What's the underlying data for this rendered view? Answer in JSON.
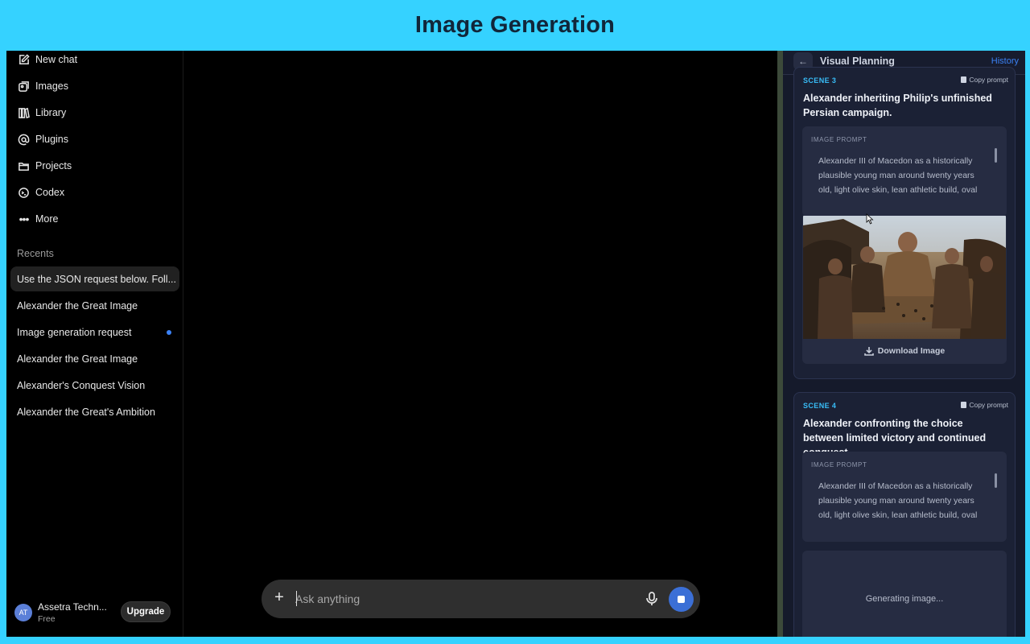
{
  "banner": {
    "title": "Image Generation"
  },
  "sidebar": {
    "nav": [
      {
        "label": "New chat",
        "icon": "edit-icon"
      },
      {
        "label": "Images",
        "icon": "images-icon"
      },
      {
        "label": "Library",
        "icon": "library-icon"
      },
      {
        "label": "Plugins",
        "icon": "at-icon"
      },
      {
        "label": "Projects",
        "icon": "folder-icon"
      },
      {
        "label": "Codex",
        "icon": "codex-icon"
      },
      {
        "label": "More",
        "icon": "more-icon"
      }
    ],
    "recents_label": "Recents",
    "recents": [
      {
        "label": "Use the JSON request below. Foll...",
        "active": true
      },
      {
        "label": "Alexander the Great Image"
      },
      {
        "label": "Image generation request",
        "unread": true
      },
      {
        "label": "Alexander the Great Image"
      },
      {
        "label": "Alexander's Conquest Vision"
      },
      {
        "label": "Alexander the Great's Ambition"
      }
    ],
    "user": {
      "initials": "AT",
      "name": "Assetra Techn...",
      "plan": "Free",
      "upgrade_label": "Upgrade"
    }
  },
  "composer": {
    "placeholder": "Ask anything"
  },
  "panel": {
    "title": "Visual Planning",
    "history_label": "History",
    "scenes": [
      {
        "label": "SCENE 3",
        "copy_label": "Copy prompt",
        "title": "Alexander inheriting Philip's unfinished Persian campaign.",
        "prompt_label": "IMAGE PROMPT",
        "prompt_text": "Alexander III of Macedon as a historically plausible young man around twenty years old, light olive skin, lean athletic build, oval face, straight nose, deep-set brown eyes",
        "download_label": "Download Image"
      },
      {
        "label": "SCENE 4",
        "copy_label": "Copy prompt",
        "title": "Alexander confronting the choice between limited victory and continued conquest.",
        "prompt_label": "IMAGE PROMPT",
        "prompt_text": "Alexander III of Macedon as a historically plausible young man around twenty years old, light olive skin, lean athletic build, oval face, straight nose, deep-set brown eyes",
        "status": "Generating image..."
      }
    ]
  },
  "colors": {
    "banner": "#35d2ff",
    "accent": "#3b6fd6",
    "scene_label": "#38bdf8"
  }
}
